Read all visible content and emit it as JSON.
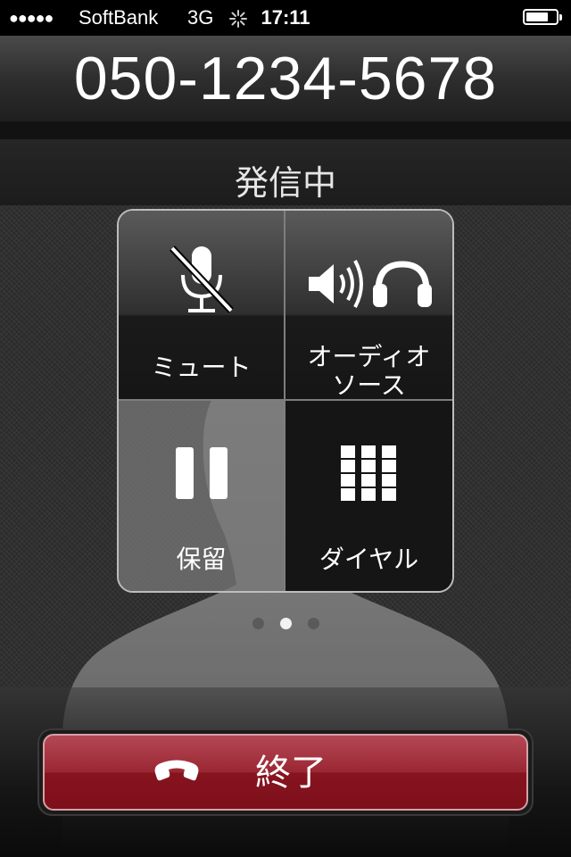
{
  "status_bar": {
    "signal": "●●●●●",
    "carrier": "SoftBank",
    "network": "3G",
    "activity": "⁘",
    "time": "17:11"
  },
  "call": {
    "number": "050-1234-5678",
    "status": "発信中"
  },
  "controls": {
    "mute_label": "ミュート",
    "audio_label_line1": "オーディオ",
    "audio_label_line2": "ソース",
    "hold_label": "保留",
    "dial_label": "ダイヤル"
  },
  "pager": {
    "pages": 3,
    "current": 2
  },
  "end_call": {
    "label": "終了"
  },
  "colors": {
    "end_button": "#9a2733",
    "panel_border": "#bdbdbd"
  }
}
